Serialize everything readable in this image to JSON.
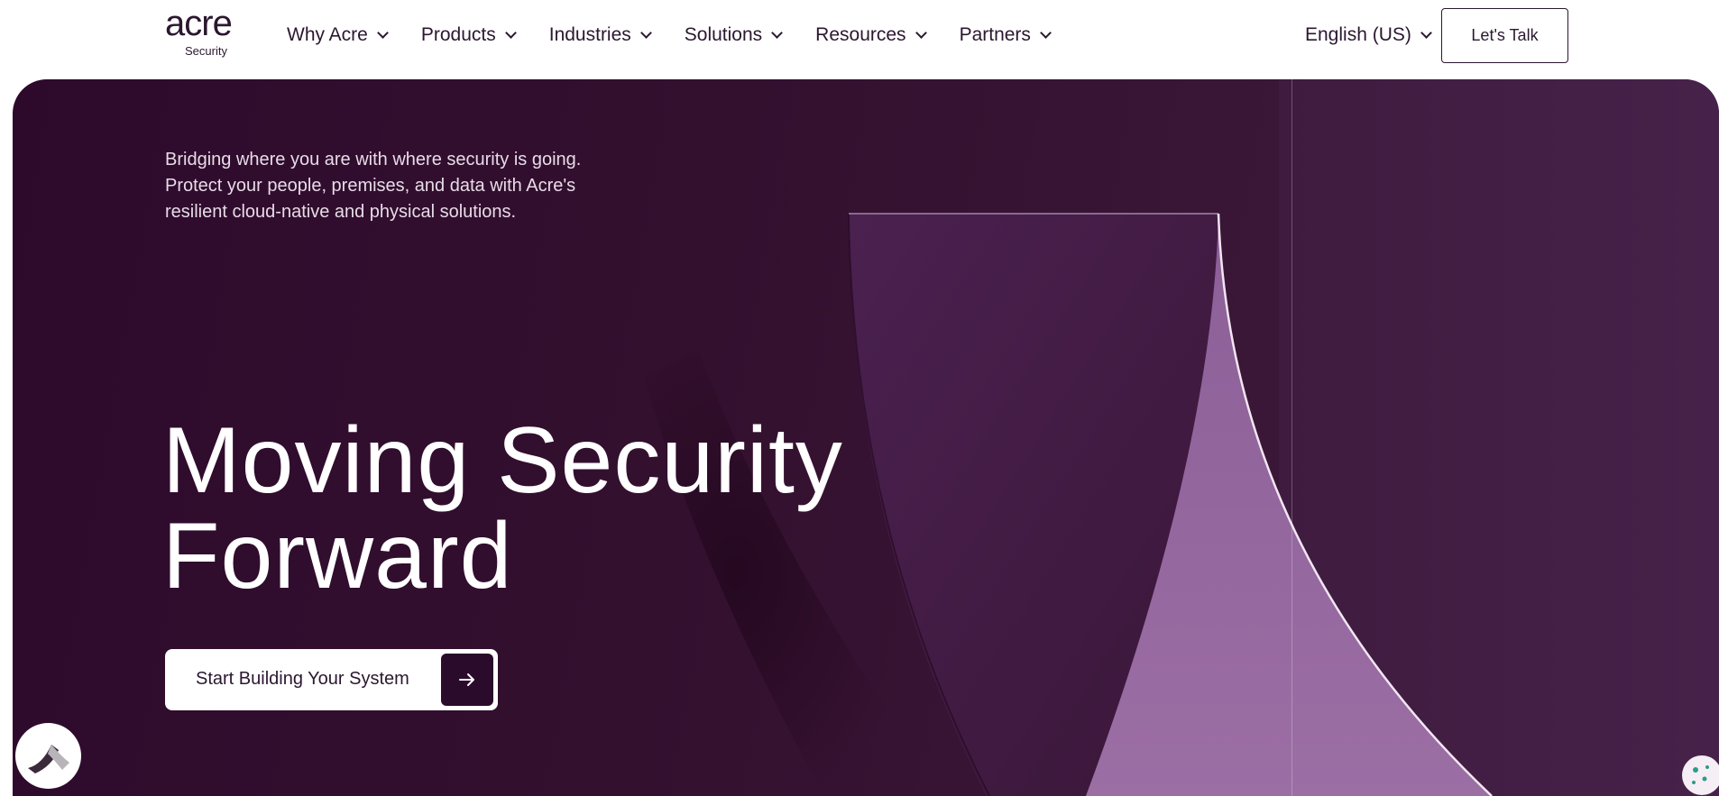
{
  "brand": {
    "name": "acre",
    "sub": "Security"
  },
  "nav": {
    "items": [
      {
        "label": "Why Acre"
      },
      {
        "label": "Products"
      },
      {
        "label": "Industries"
      },
      {
        "label": "Solutions"
      },
      {
        "label": "Resources"
      },
      {
        "label": "Partners"
      }
    ]
  },
  "language": {
    "label": "English (US)"
  },
  "header": {
    "cta_label": "Let's Talk"
  },
  "hero": {
    "intro": "Bridging where you are with where security is going. Protect your people, premises, and data with Acre's resilient cloud-native and physical solutions.",
    "headline_line1": "Moving Security",
    "headline_line2": "Forward",
    "cta_label": "Start Building Your System"
  },
  "colors": {
    "brand_dark": "#2b1730",
    "hero_bg": "#34102f",
    "accent_light_purple": "#8a5d95"
  },
  "icons": {
    "cta_arrow": "arrow-right-icon",
    "widget_left": "acre-mark-icon",
    "widget_right": "cookie-icon"
  }
}
